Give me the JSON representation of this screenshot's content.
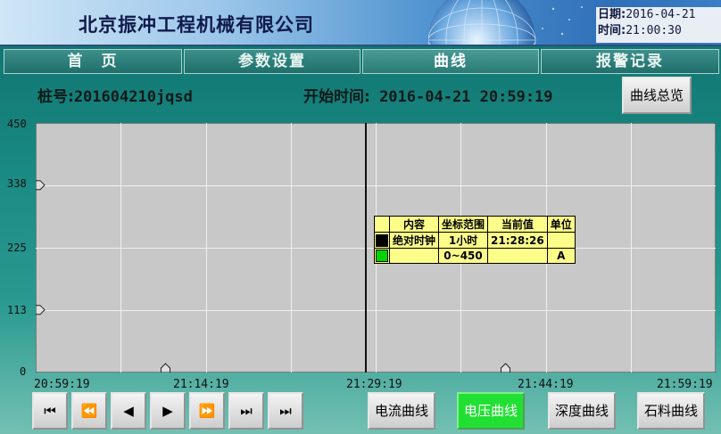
{
  "header": {
    "company": "北京振冲工程机械有限公司",
    "date_label": "日期:",
    "date_value": "2016-04-21",
    "time_label": "时间:",
    "time_value": "21:00:30"
  },
  "nav": {
    "tabs": [
      {
        "label": "首　页"
      },
      {
        "label": "参数设置"
      },
      {
        "label": "曲线"
      },
      {
        "label": "报警记录"
      }
    ],
    "active_tab": "曲线"
  },
  "info": {
    "pile_label": "桩号:",
    "pile_value": "201604210jqsd",
    "start_label": "开始时间:",
    "start_value": "2016-04-21 20:59:19",
    "overview_button": "曲线总览"
  },
  "chart_data": {
    "type": "line",
    "y_ticks": [
      "450",
      "338",
      "225",
      "113",
      "0"
    ],
    "x_ticks": [
      "20:59:19",
      "21:14:19",
      "21:29:19",
      "21:44:19",
      "21:59:19"
    ],
    "ylim": [
      0,
      450
    ],
    "grid": true,
    "cursor_time": "21:29:19",
    "series": []
  },
  "legend": {
    "headers": [
      "内容",
      "坐标范围",
      "当前值",
      "单位"
    ],
    "rows": [
      {
        "color": "#000000",
        "content": "绝对时钟",
        "range": "1小时",
        "current": "21:28:26",
        "unit": ""
      },
      {
        "color": "#00d400",
        "content": "",
        "range": "0~450",
        "current": "",
        "unit": "A"
      }
    ]
  },
  "controls": {
    "playback": [
      "⏮",
      "⏪",
      "◀",
      "▶",
      "⏩",
      "⏭",
      "⏭"
    ],
    "curve_buttons": [
      {
        "label": "电流曲线"
      },
      {
        "label": "电压曲线"
      },
      {
        "label": "深度曲线"
      },
      {
        "label": "石料曲线"
      }
    ],
    "active_curve": "电压曲线"
  }
}
